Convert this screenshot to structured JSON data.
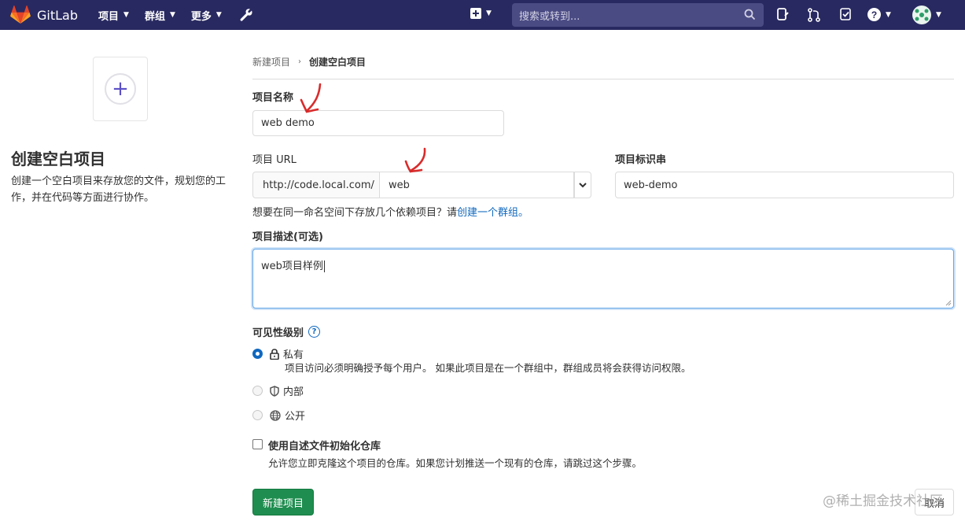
{
  "nav": {
    "brand": "GitLab",
    "projects": "项目",
    "groups": "群组",
    "more": "更多",
    "search_placeholder": "搜索或转到..."
  },
  "breadcrumb": {
    "parent": "新建项目",
    "current": "创建空白项目"
  },
  "sidebar": {
    "title": "创建空白项目",
    "description": "创建一个空白项目来存放您的文件，规划您的工作，并在代码等方面进行协作。"
  },
  "form": {
    "name_label": "项目名称",
    "name_value": "web demo",
    "url_label": "项目 URL",
    "url_prefix": "http://code.local.com/",
    "url_namespace": "web",
    "slug_label": "项目标识串",
    "slug_value": "web-demo",
    "help_text": "想要在同一命名空间下存放几个依赖项目？请",
    "help_link": "创建一个群组。",
    "desc_label": "项目描述(可选)",
    "desc_value": "web项目样例",
    "visibility_label": "可见性级别",
    "visibility_options": [
      {
        "label": "私有",
        "description": "项目访问必须明确授予每个用户。 如果此项目是在一个群组中，群组成员将会获得访问权限。",
        "selected": true
      },
      {
        "label": "内部",
        "selected": false
      },
      {
        "label": "公开",
        "selected": false
      }
    ],
    "init_readme_label": "使用自述文件初始化仓库",
    "init_readme_desc": "允许您立即克隆这个项目的仓库。如果您计划推送一个现有的仓库，请跳过这个步骤。",
    "submit": "新建项目",
    "cancel": "取消"
  },
  "watermark": "@稀土掘金技术社区",
  "colors": {
    "nav_bg": "#292961",
    "primary": "#1f8d4f",
    "link": "#1068bf",
    "annotation": "#d92b2b"
  }
}
